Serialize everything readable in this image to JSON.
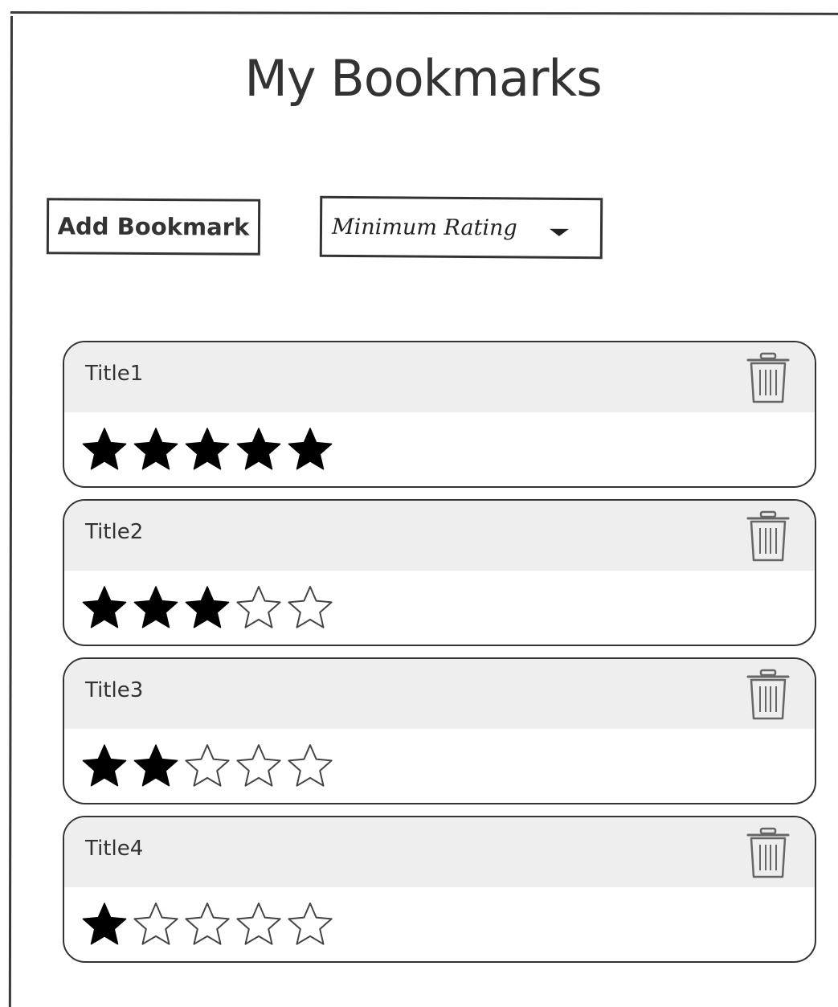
{
  "page": {
    "title": "My Bookmarks"
  },
  "toolbar": {
    "add_label": "Add Bookmark",
    "rating_filter_label": "Minimum Rating"
  },
  "bookmarks": [
    {
      "title": "Title1",
      "rating": 5
    },
    {
      "title": "Title2",
      "rating": 3
    },
    {
      "title": "Title3",
      "rating": 2
    },
    {
      "title": "Title4",
      "rating": 1
    }
  ],
  "rating_max": 5,
  "icons": {
    "delete": "trash-icon",
    "star_filled": "star-filled-icon",
    "star_empty": "star-empty-icon",
    "dropdown": "chevron-down-icon"
  },
  "colors": {
    "ink": "#333333",
    "header_bg": "#eeeeee",
    "star_fill": "#000000",
    "trash": "#666666"
  }
}
